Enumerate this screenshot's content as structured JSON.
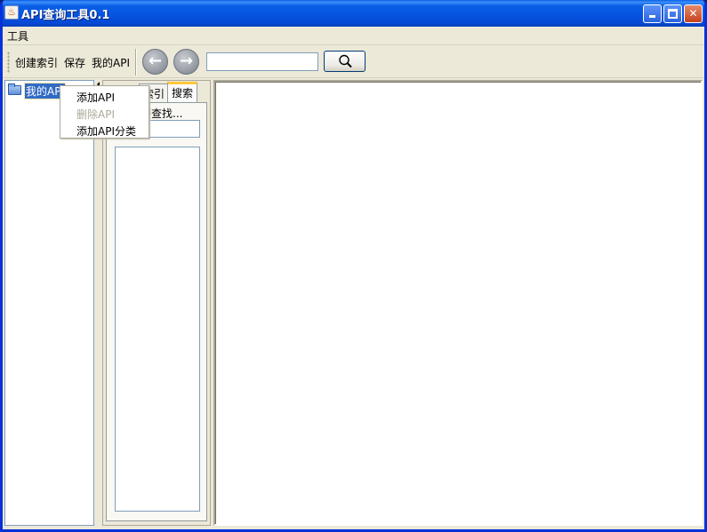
{
  "window": {
    "title": "API查询工具0.1",
    "app_icon": "java-icon",
    "controls": [
      "minimize",
      "maximize",
      "close"
    ]
  },
  "menubar": {
    "items": [
      "工具"
    ]
  },
  "toolbar": {
    "create_index": "创建索引",
    "save": "保存",
    "my_api": "我的API",
    "back_icon": "arrow-left-icon",
    "forward_icon": "arrow-right-icon",
    "search_value": "",
    "search_icon": "magnifier-icon"
  },
  "tree": {
    "root_label": "我的API",
    "root_icon": "folder-icon"
  },
  "context_menu": {
    "items": [
      {
        "label": "添加API",
        "enabled": true
      },
      {
        "label": "删除API",
        "enabled": false
      },
      {
        "label": "添加API分类",
        "enabled": true
      }
    ]
  },
  "side_tabs": {
    "tabs": [
      "索引",
      "搜索"
    ],
    "active": "搜索",
    "search_hint": "要查找..."
  },
  "colors": {
    "title_bar": "#0a5fe6",
    "selection": "#316ac5",
    "window_bg": "#ece9d8",
    "active_tab_accent": "#ffc83c"
  }
}
